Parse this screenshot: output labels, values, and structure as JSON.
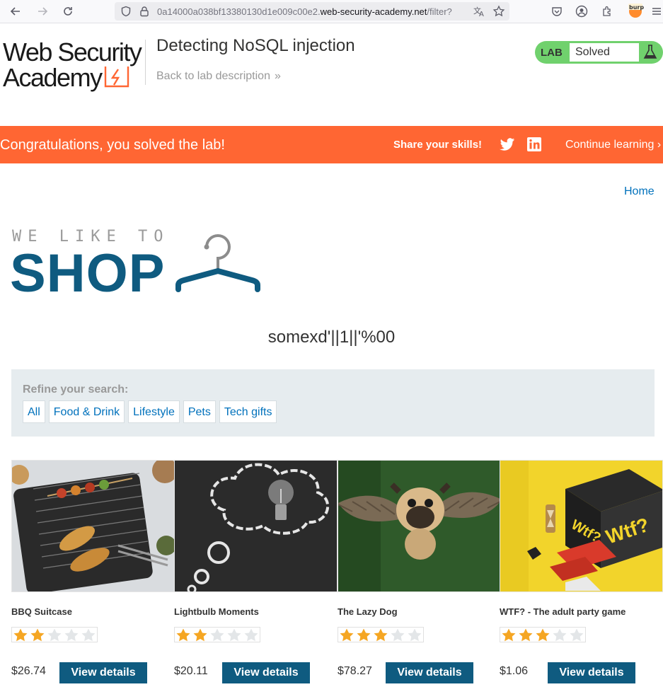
{
  "browser": {
    "url_dim_prefix": "0a14000a038bf13380130d1e009c00e2.",
    "url_domain": "web-security-academy.net",
    "url_path": "/filter?"
  },
  "header": {
    "logo_text": "Web Security Academy",
    "lab_title": "Detecting NoSQL injection",
    "back_link": "Back to lab description",
    "lab_tag": "LAB",
    "lab_status": "Solved"
  },
  "banner": {
    "message": "Congratulations, you solved the lab!",
    "share_label": "Share your skills!",
    "continue_label": "Continue learning"
  },
  "nav": {
    "home": "Home"
  },
  "shop_logo": {
    "tagline": "WE LIKE TO",
    "word": "SHOP"
  },
  "search": {
    "term": "somexd'||1||'%00"
  },
  "filters": {
    "label": "Refine your search:",
    "items": [
      "All",
      "Food & Drink",
      "Lifestyle",
      "Pets",
      "Tech gifts"
    ]
  },
  "colors": {
    "accent": "#ff6633",
    "brand_blue": "#0f5b80",
    "link": "#0071bc",
    "lab_green": "#70d16d",
    "star": "#f5a623"
  },
  "products": [
    {
      "name": "BBQ Suitcase",
      "rating": 2,
      "price": "$26.74",
      "button": "View details",
      "image": "bbq-grill-photo"
    },
    {
      "name": "Lightbulb Moments",
      "rating": 2,
      "price": "$20.11",
      "button": "View details",
      "image": "lightbulb-chalkboard-photo"
    },
    {
      "name": "The Lazy Dog",
      "rating": 3,
      "price": "$78.27",
      "button": "View details",
      "image": "flying-pug-photo"
    },
    {
      "name": "WTF? - The adult party game",
      "rating": 3,
      "price": "$1.06",
      "button": "View details",
      "image": "party-game-box-photo"
    }
  ]
}
